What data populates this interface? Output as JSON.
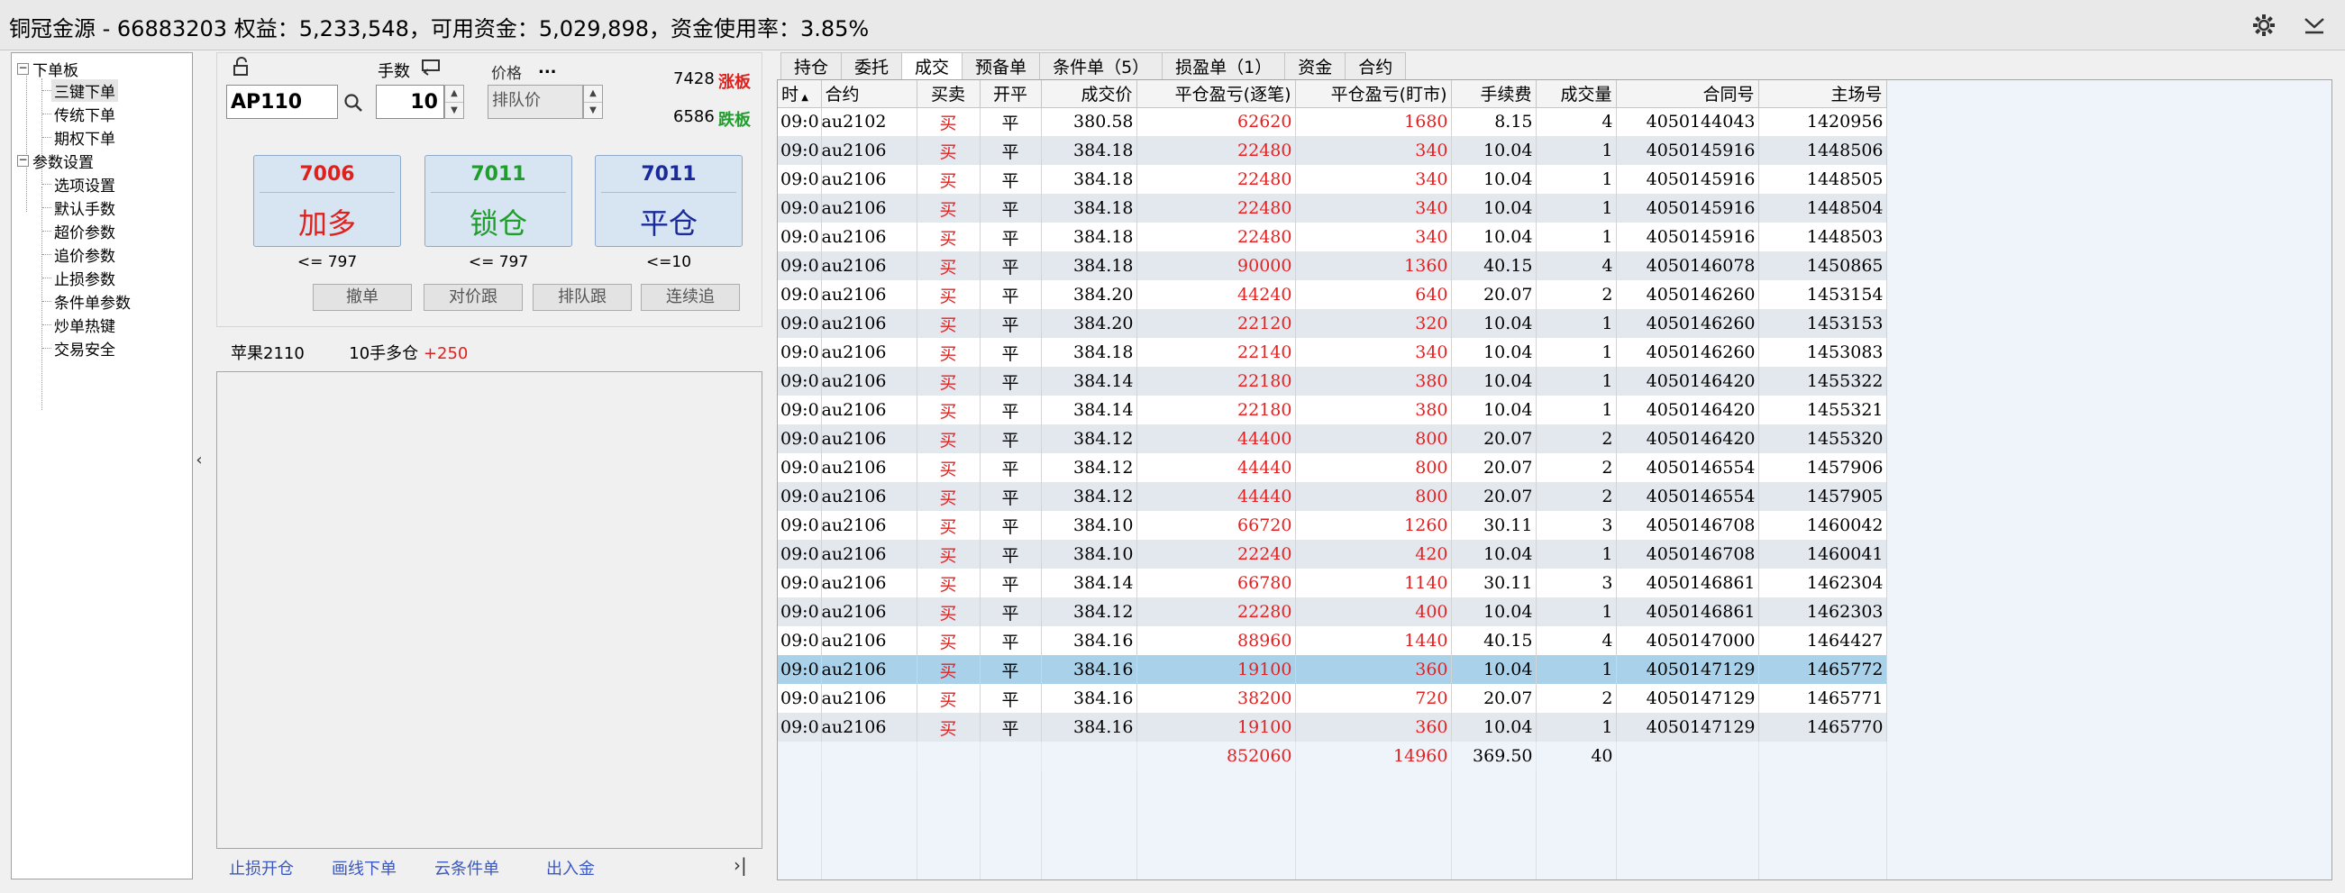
{
  "titlebar": {
    "title": "铜冠金源 - 66883203  权益：5,233,548，可用资金：5,029,898，资金使用率：3.85%"
  },
  "tree": {
    "groups": [
      {
        "label": "下单板",
        "items": [
          "三键下单",
          "传统下单",
          "期权下单"
        ],
        "selected": 0
      },
      {
        "label": "参数设置",
        "items": [
          "选项设置",
          "默认手数",
          "超价参数",
          "追价参数",
          "止损参数",
          "条件单参数",
          "炒单热键",
          "交易安全"
        ]
      }
    ]
  },
  "order": {
    "lots_label": "手数",
    "price_label": "价格",
    "price_ellipsis": "...",
    "symbol_value": "AP110",
    "lots_value": "10",
    "price_value": "排队价",
    "limit_up_value": "7428",
    "limit_up_label": "涨板",
    "limit_down_value": "6586",
    "limit_down_label": "跌板",
    "buttons": [
      {
        "price": "7006",
        "label": "加多",
        "limit": "<= 797",
        "color": "#e0201c"
      },
      {
        "price": "7011",
        "label": "锁仓",
        "limit": "<= 797",
        "color": "#1e9e2a"
      },
      {
        "price": "7011",
        "label": "平仓",
        "limit": "<=10",
        "color": "#1a2a9a"
      }
    ],
    "small_buttons": [
      "撤单",
      "对价跟",
      "排队跟",
      "连续追"
    ]
  },
  "position_line": {
    "name": "苹果2110",
    "text": "10手多仓",
    "pnl": "+250"
  },
  "bottom_links": [
    "止损开仓",
    "画线下单",
    "云条件单",
    "出入金"
  ],
  "tabs": [
    "持仓",
    "委托",
    "成交",
    "预备单",
    "条件单（5）",
    "损盈单（1）",
    "资金",
    "合约"
  ],
  "active_tab": 2,
  "table": {
    "columns": [
      "时",
      "合约",
      "买卖",
      "开平",
      "成交价",
      "平仓盈亏(逐笔)",
      "平仓盈亏(盯市)",
      "手续费",
      "成交量",
      "合同号",
      "主场号"
    ],
    "rows": [
      [
        "09:0",
        "au2102",
        "买",
        "平",
        "380.58",
        "62620",
        "1680",
        "8.15",
        "4",
        "4050144043",
        "1420956"
      ],
      [
        "09:0",
        "au2106",
        "买",
        "平",
        "384.18",
        "22480",
        "340",
        "10.04",
        "1",
        "4050145916",
        "1448506"
      ],
      [
        "09:0",
        "au2106",
        "买",
        "平",
        "384.18",
        "22480",
        "340",
        "10.04",
        "1",
        "4050145916",
        "1448505"
      ],
      [
        "09:0",
        "au2106",
        "买",
        "平",
        "384.18",
        "22480",
        "340",
        "10.04",
        "1",
        "4050145916",
        "1448504"
      ],
      [
        "09:0",
        "au2106",
        "买",
        "平",
        "384.18",
        "22480",
        "340",
        "10.04",
        "1",
        "4050145916",
        "1448503"
      ],
      [
        "09:0",
        "au2106",
        "买",
        "平",
        "384.18",
        "90000",
        "1360",
        "40.15",
        "4",
        "4050146078",
        "1450865"
      ],
      [
        "09:0",
        "au2106",
        "买",
        "平",
        "384.20",
        "44240",
        "640",
        "20.07",
        "2",
        "4050146260",
        "1453154"
      ],
      [
        "09:0",
        "au2106",
        "买",
        "平",
        "384.20",
        "22120",
        "320",
        "10.04",
        "1",
        "4050146260",
        "1453153"
      ],
      [
        "09:0",
        "au2106",
        "买",
        "平",
        "384.18",
        "22140",
        "340",
        "10.04",
        "1",
        "4050146260",
        "1453083"
      ],
      [
        "09:0",
        "au2106",
        "买",
        "平",
        "384.14",
        "22180",
        "380",
        "10.04",
        "1",
        "4050146420",
        "1455322"
      ],
      [
        "09:0",
        "au2106",
        "买",
        "平",
        "384.14",
        "22180",
        "380",
        "10.04",
        "1",
        "4050146420",
        "1455321"
      ],
      [
        "09:0",
        "au2106",
        "买",
        "平",
        "384.12",
        "44400",
        "800",
        "20.07",
        "2",
        "4050146420",
        "1455320"
      ],
      [
        "09:0",
        "au2106",
        "买",
        "平",
        "384.12",
        "44440",
        "800",
        "20.07",
        "2",
        "4050146554",
        "1457906"
      ],
      [
        "09:0",
        "au2106",
        "买",
        "平",
        "384.12",
        "44440",
        "800",
        "20.07",
        "2",
        "4050146554",
        "1457905"
      ],
      [
        "09:0",
        "au2106",
        "买",
        "平",
        "384.10",
        "66720",
        "1260",
        "30.11",
        "3",
        "4050146708",
        "1460042"
      ],
      [
        "09:0",
        "au2106",
        "买",
        "平",
        "384.10",
        "22240",
        "420",
        "10.04",
        "1",
        "4050146708",
        "1460041"
      ],
      [
        "09:0",
        "au2106",
        "买",
        "平",
        "384.14",
        "66780",
        "1140",
        "30.11",
        "3",
        "4050146861",
        "1462304"
      ],
      [
        "09:0",
        "au2106",
        "买",
        "平",
        "384.12",
        "22280",
        "400",
        "10.04",
        "1",
        "4050146861",
        "1462303"
      ],
      [
        "09:0",
        "au2106",
        "买",
        "平",
        "384.16",
        "88960",
        "1440",
        "40.15",
        "4",
        "4050147000",
        "1464427"
      ],
      [
        "09:0",
        "au2106",
        "买",
        "平",
        "384.16",
        "19100",
        "360",
        "10.04",
        "1",
        "4050147129",
        "1465772"
      ],
      [
        "09:0",
        "au2106",
        "买",
        "平",
        "384.16",
        "38200",
        "720",
        "20.07",
        "2",
        "4050147129",
        "1465771"
      ],
      [
        "09:0",
        "au2106",
        "买",
        "平",
        "384.16",
        "19100",
        "360",
        "10.04",
        "1",
        "4050147129",
        "1465770"
      ]
    ],
    "selected_row": 19,
    "totals": {
      "pnl_trade": "852060",
      "pnl_mark": "14960",
      "fee": "369.50",
      "volume": "40"
    }
  },
  "icons": {
    "settings": "gear-icon",
    "collapse": "chevron-down-icon",
    "lock": "unlock-icon",
    "search": "search-icon"
  }
}
